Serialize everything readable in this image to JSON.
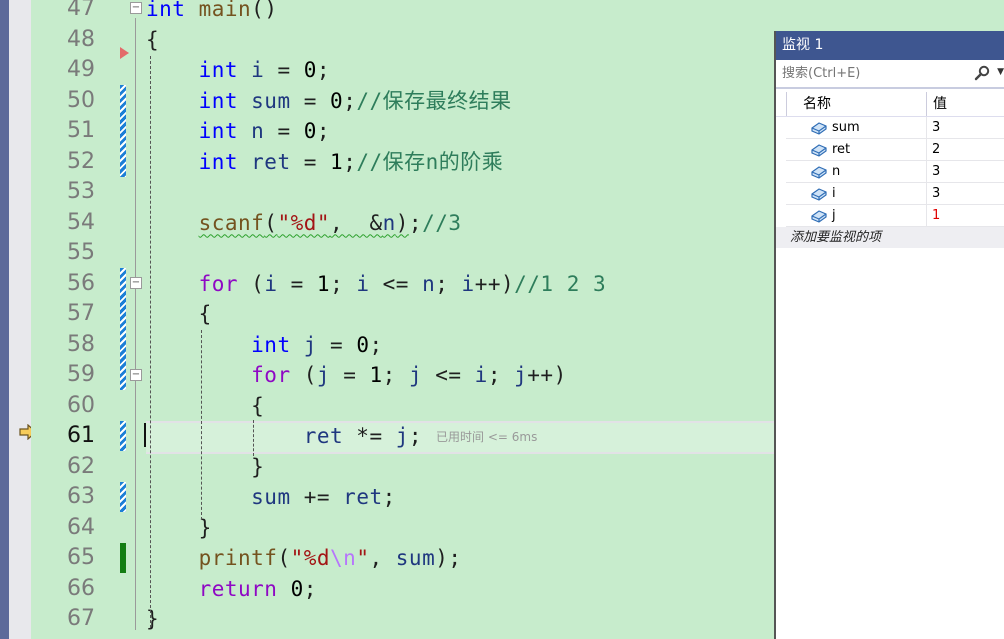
{
  "editor": {
    "current_line": 61,
    "lines": [
      {
        "n": 47,
        "tokens": [
          [
            "kw",
            "int"
          ],
          [
            "",
            " "
          ],
          [
            "fn",
            "main"
          ],
          [
            "",
            "()"
          ]
        ]
      },
      {
        "n": 48,
        "tokens": [
          [
            "",
            "{"
          ]
        ]
      },
      {
        "n": 49,
        "tokens": [
          [
            "",
            "    "
          ],
          [
            "kw",
            "int"
          ],
          [
            "",
            ""
          ],
          [
            "var",
            " i"
          ],
          [
            "",
            " = "
          ],
          [
            "num",
            "0"
          ],
          [
            "",
            ";"
          ]
        ]
      },
      {
        "n": 50,
        "tokens": [
          [
            "",
            "    "
          ],
          [
            "kw",
            "int"
          ],
          [
            "var",
            " sum"
          ],
          [
            "",
            " = "
          ],
          [
            "num",
            "0"
          ],
          [
            "",
            ";"
          ],
          [
            "cm",
            "//保存最终结果"
          ]
        ]
      },
      {
        "n": 51,
        "tokens": [
          [
            "",
            "    "
          ],
          [
            "kw",
            "int"
          ],
          [
            "var",
            " n"
          ],
          [
            "",
            " = "
          ],
          [
            "num",
            "0"
          ],
          [
            "",
            ";"
          ]
        ]
      },
      {
        "n": 52,
        "tokens": [
          [
            "",
            "    "
          ],
          [
            "kw",
            "int"
          ],
          [
            "var",
            " ret"
          ],
          [
            "",
            " = "
          ],
          [
            "num",
            "1"
          ],
          [
            "",
            ";"
          ],
          [
            "cm",
            "//保存n的阶乘"
          ]
        ]
      },
      {
        "n": 53,
        "tokens": []
      },
      {
        "n": 54,
        "tokens": [
          [
            "",
            "    "
          ],
          [
            "fn squig",
            "scanf"
          ],
          [
            "squig",
            "("
          ],
          [
            "str squig",
            "\"%d\""
          ],
          [
            "squig",
            ",  &"
          ],
          [
            "var squig",
            "n"
          ],
          [
            "squig",
            ")"
          ],
          [
            "",
            ";"
          ],
          [
            "cm",
            "//3"
          ]
        ]
      },
      {
        "n": 55,
        "tokens": []
      },
      {
        "n": 56,
        "tokens": [
          [
            "",
            "    "
          ],
          [
            "kw2",
            "for"
          ],
          [
            "",
            " ("
          ],
          [
            "var",
            "i"
          ],
          [
            "",
            " = "
          ],
          [
            "num",
            "1"
          ],
          [
            "",
            "; "
          ],
          [
            "var",
            "i"
          ],
          [
            "",
            " <= "
          ],
          [
            "var",
            "n"
          ],
          [
            "",
            "; "
          ],
          [
            "var",
            "i"
          ],
          [
            "",
            "++)"
          ],
          [
            "cm",
            "//1 2 3"
          ]
        ]
      },
      {
        "n": 57,
        "tokens": [
          [
            "",
            "    {"
          ]
        ]
      },
      {
        "n": 58,
        "tokens": [
          [
            "",
            "        "
          ],
          [
            "kw",
            "int"
          ],
          [
            "var",
            " j"
          ],
          [
            "",
            " = "
          ],
          [
            "num",
            "0"
          ],
          [
            "",
            ";"
          ]
        ]
      },
      {
        "n": 59,
        "tokens": [
          [
            "",
            "        "
          ],
          [
            "kw2",
            "for"
          ],
          [
            "",
            " ("
          ],
          [
            "var",
            "j"
          ],
          [
            "",
            " = "
          ],
          [
            "num",
            "1"
          ],
          [
            "",
            "; "
          ],
          [
            "var",
            "j"
          ],
          [
            "",
            " <= "
          ],
          [
            "var",
            "i"
          ],
          [
            "",
            "; "
          ],
          [
            "var",
            "j"
          ],
          [
            "",
            "++)"
          ]
        ]
      },
      {
        "n": 60,
        "tokens": [
          [
            "",
            "        {"
          ]
        ]
      },
      {
        "n": 61,
        "tokens": [
          [
            "",
            "            "
          ],
          [
            "var",
            "ret"
          ],
          [
            "",
            " *= "
          ],
          [
            "var",
            "j"
          ],
          [
            "",
            ";"
          ]
        ],
        "hint": "已用时间 <= 6ms"
      },
      {
        "n": 62,
        "tokens": [
          [
            "",
            "        }"
          ]
        ]
      },
      {
        "n": 63,
        "tokens": [
          [
            "",
            "        "
          ],
          [
            "var",
            "sum"
          ],
          [
            "",
            " += "
          ],
          [
            "var",
            "ret"
          ],
          [
            "",
            ";"
          ]
        ]
      },
      {
        "n": 64,
        "tokens": [
          [
            "",
            "    }"
          ]
        ]
      },
      {
        "n": 65,
        "tokens": [
          [
            "",
            "    "
          ],
          [
            "fn",
            "printf"
          ],
          [
            "",
            "("
          ],
          [
            "str",
            "\"%d"
          ],
          [
            "esc",
            "\\n"
          ],
          [
            "str",
            "\""
          ],
          [
            "",
            ", "
          ],
          [
            "var",
            "sum"
          ],
          [
            "",
            ");"
          ]
        ]
      },
      {
        "n": 66,
        "tokens": [
          [
            "",
            "    "
          ],
          [
            "kw2",
            "return"
          ],
          [
            "",
            " "
          ],
          [
            "num",
            "0"
          ],
          [
            "",
            ";"
          ]
        ]
      },
      {
        "n": 67,
        "tokens": [
          [
            "",
            "}"
          ]
        ]
      }
    ]
  },
  "watch": {
    "title": "监视 1",
    "search_placeholder": "搜索(Ctrl+E)",
    "columns": {
      "name": "名称",
      "value": "值"
    },
    "rows": [
      {
        "name": "sum",
        "value": "3",
        "changed": false
      },
      {
        "name": "ret",
        "value": "2",
        "changed": false
      },
      {
        "name": "n",
        "value": "3",
        "changed": false
      },
      {
        "name": "i",
        "value": "3",
        "changed": false
      },
      {
        "name": "j",
        "value": "1",
        "changed": true
      }
    ],
    "add_item_label": "添加要监视的项"
  }
}
